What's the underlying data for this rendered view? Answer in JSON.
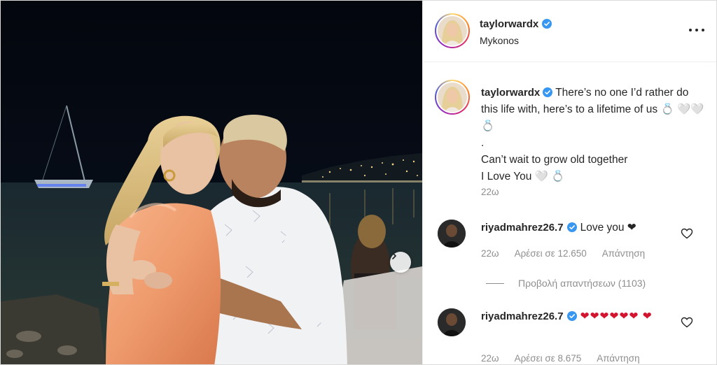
{
  "post": {
    "username": "taylorwardx",
    "location": "Mykonos",
    "verified": true,
    "caption_line1": "There’s no one I’d rather do this life with, here’s to a lifetime of us 💍 🤍🤍 💍",
    "caption_line2": ".",
    "caption_line3": "Can’t wait to grow old together",
    "caption_line4": "I Love You 🤍 💍",
    "time": "22ω",
    "icons": {
      "more": "more-options-icon",
      "verified": "verified-badge-icon",
      "carousel": "chevron-right-icon",
      "like": "heart-outline-icon"
    }
  },
  "comments": [
    {
      "username": "riyadmahrez26.7",
      "text": "Love you ❤",
      "time": "22ω",
      "likes": "Αρέσει σε 12.650",
      "reply": "Απάντηση",
      "view_replies": "Προβολή απαντήσεων (1103)"
    },
    {
      "username": "riyadmahrez26.7",
      "text": "❤❤❤❤❤❤ ❤",
      "time": "22ω",
      "likes": "Αρέσει σε 8.675",
      "reply": "Απάντηση"
    }
  ],
  "colors": {
    "verified": "#3897f0",
    "heart": "#d3142e",
    "muted": "#8e8e8e",
    "text": "#262626"
  }
}
